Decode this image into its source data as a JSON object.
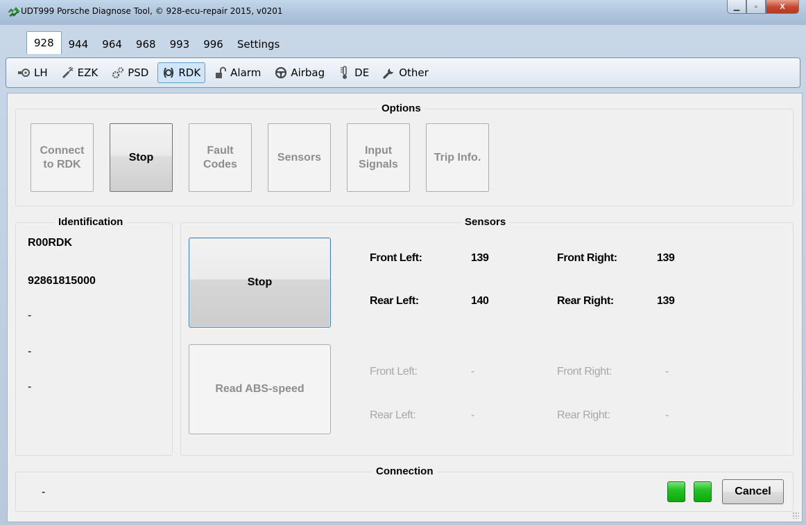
{
  "window": {
    "title": "UDT999 Porsche Diagnose Tool, © 928-ecu-repair 2015, v0201",
    "close_glyph": "X",
    "app_icon": "app-logo-icon"
  },
  "tabs": [
    {
      "label": "928",
      "active": true
    },
    {
      "label": "944",
      "active": false
    },
    {
      "label": "964",
      "active": false
    },
    {
      "label": "968",
      "active": false
    },
    {
      "label": "993",
      "active": false
    },
    {
      "label": "996",
      "active": false
    },
    {
      "label": "Settings",
      "active": false
    }
  ],
  "modules": [
    {
      "label": "LH",
      "icon": "lh-sensor-icon",
      "active": false
    },
    {
      "label": "EZK",
      "icon": "ignition-icon",
      "active": false
    },
    {
      "label": "PSD",
      "icon": "gears-icon",
      "active": false
    },
    {
      "label": "RDK",
      "icon": "tire-pressure-icon",
      "active": true
    },
    {
      "label": "Alarm",
      "icon": "lock-icon",
      "active": false
    },
    {
      "label": "Airbag",
      "icon": "steering-wheel-icon",
      "active": false
    },
    {
      "label": "DE",
      "icon": "thermometer-icon",
      "active": false
    },
    {
      "label": "Other",
      "icon": "wrench-icon",
      "active": false
    }
  ],
  "options": {
    "title": "Options",
    "buttons": [
      {
        "label": "Connect\nto RDK",
        "enabled": false
      },
      {
        "label": "Stop",
        "enabled": true
      },
      {
        "label": "Fault\nCodes",
        "enabled": false
      },
      {
        "label": "Sensors",
        "enabled": false
      },
      {
        "label": "Input\nSignals",
        "enabled": false
      },
      {
        "label": "Trip Info.",
        "enabled": false
      }
    ]
  },
  "identification": {
    "title": "Identification",
    "values": [
      "R00RDK",
      "92861815000",
      "-",
      "-",
      "-"
    ]
  },
  "sensors": {
    "title": "Sensors",
    "stop_button": "Stop",
    "abs_button": "Read ABS-speed",
    "pressure": {
      "front_left_label": "Front Left:",
      "front_left": "139",
      "front_right_label": "Front Right:",
      "front_right": "139",
      "rear_left_label": "Rear Left:",
      "rear_left": "140",
      "rear_right_label": "Rear Right:",
      "rear_right": "139"
    },
    "abs": {
      "front_left_label": "Front Left:",
      "front_left": "-",
      "front_right_label": "Front Right:",
      "front_right": "-",
      "rear_left_label": "Rear Left:",
      "rear_left": "-",
      "rear_right_label": "Rear Right:",
      "rear_right": "-"
    }
  },
  "connection": {
    "title": "Connection",
    "status": "-",
    "cancel_label": "Cancel",
    "led_color": "#1fbf1f"
  }
}
